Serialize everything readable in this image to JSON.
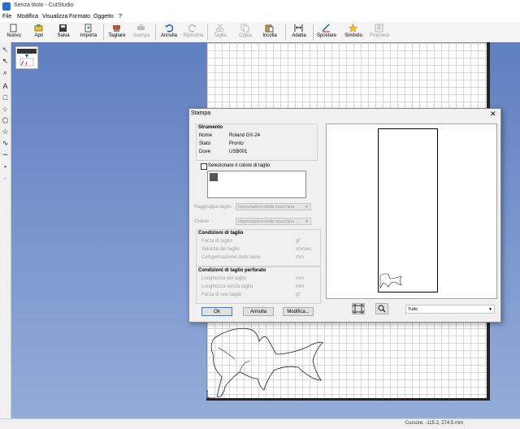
{
  "window": {
    "title": "Senza titolo - CutStudio"
  },
  "menu": [
    "File",
    "Modifica",
    "Visualizza",
    "Formato",
    "Oggetto",
    "?"
  ],
  "toolbar": [
    {
      "name": "nuovo",
      "label": "Nuovo",
      "enabled": true
    },
    {
      "name": "apri",
      "label": "Apri",
      "enabled": true
    },
    {
      "name": "salva",
      "label": "Salva",
      "enabled": true
    },
    {
      "name": "importa",
      "label": "Importa",
      "enabled": true
    },
    {
      "name": "tagliare",
      "label": "Tagliare",
      "enabled": true
    },
    {
      "name": "stampa",
      "label": "Stampa",
      "enabled": false
    },
    {
      "name": "annulla",
      "label": "Annulla",
      "enabled": true
    },
    {
      "name": "ripristina",
      "label": "Ripristina",
      "enabled": false
    },
    {
      "name": "taglia",
      "label": "Taglia",
      "enabled": false
    },
    {
      "name": "copia",
      "label": "Copia",
      "enabled": false
    },
    {
      "name": "incolla",
      "label": "Incolla",
      "enabled": true
    },
    {
      "name": "adatta",
      "label": "Adatta",
      "enabled": true
    },
    {
      "name": "spostare",
      "label": "Spostare",
      "enabled": true
    },
    {
      "name": "simbolo",
      "label": "Simbolo",
      "enabled": true
    },
    {
      "name": "proprieta",
      "label": "Proprietà",
      "enabled": false
    }
  ],
  "palette_glyphs": [
    "↖",
    "↖",
    "⌕",
    "A",
    "□",
    "○",
    "⬠",
    "☆",
    "∿",
    "∼",
    "▪",
    "▫"
  ],
  "status": {
    "cursor": "Cursore: -115.2, 274.5 mm"
  },
  "dialog": {
    "title": "Stampa",
    "close": "✕",
    "device_group": "Strumento",
    "device_rows": [
      {
        "key": "Nome",
        "value": "Roland GX-24"
      },
      {
        "key": "Stato",
        "value": "Pronto"
      },
      {
        "key": "Dove",
        "value": "USB001"
      }
    ],
    "select_colors_label": "Selezionare il colore di taglio",
    "gruppo_label": "Raggruppa taglio",
    "gruppo_value": "Impostazioni della macchina",
    "ordine_label": "Ordine",
    "ordine_value": "Impostazioni della macchina",
    "cond_group": "Condizioni di taglio",
    "cond_rows": [
      {
        "key": "Forza di taglio",
        "value": "gf"
      },
      {
        "key": "Velocità del taglio",
        "value": "cm/sec"
      },
      {
        "key": "Compensazione della lama",
        "value": "mm"
      }
    ],
    "perf_group": "Condizioni di taglio perforato",
    "perf_rows": [
      {
        "key": "Lunghezza del taglio",
        "value": "mm"
      },
      {
        "key": "Lunghezza senza taglio",
        "value": "mm"
      },
      {
        "key": "Forza di non taglio",
        "value": "gf"
      }
    ],
    "ok_label": "Ok",
    "cancel_label": "Annulla",
    "modify_label": "Modifica...",
    "zoom_value": "Tutto"
  }
}
